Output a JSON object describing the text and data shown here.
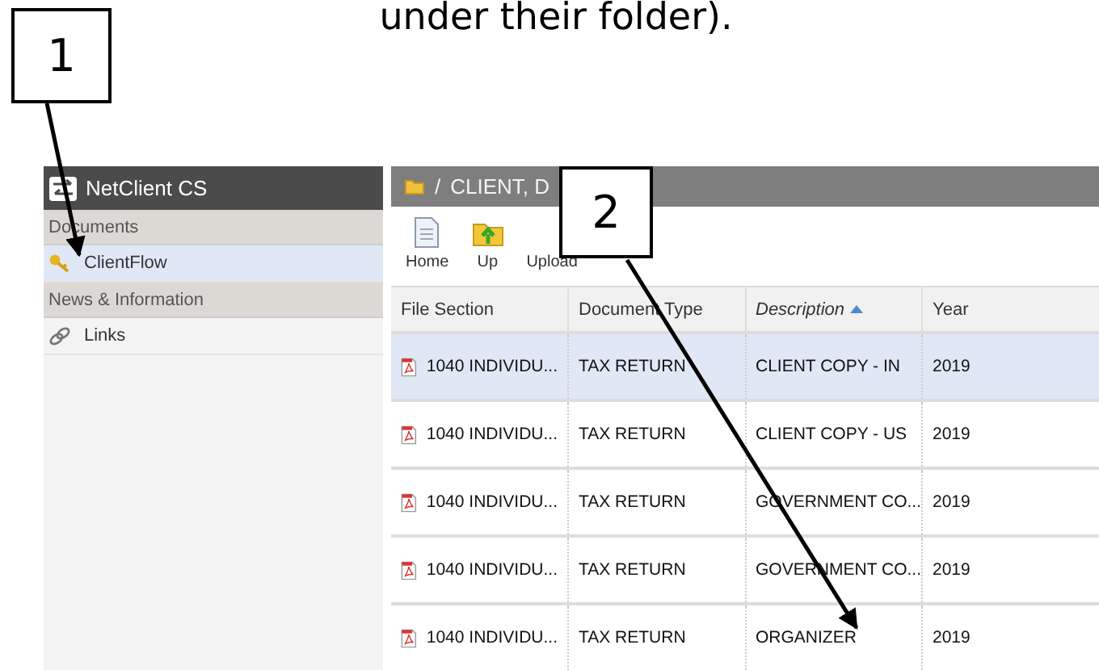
{
  "caption": "under their folder).",
  "callouts": [
    {
      "number": "1"
    },
    {
      "number": "2"
    }
  ],
  "sidebar": {
    "title": "NetClient CS",
    "sections": [
      {
        "heading": "Documents",
        "items": [
          {
            "label": "ClientFlow",
            "kind": "flow",
            "selected": true
          }
        ]
      },
      {
        "heading": "News & Information",
        "items": [
          {
            "label": "Links",
            "kind": "link",
            "selected": false
          }
        ]
      }
    ]
  },
  "path": {
    "separator": "/",
    "text": "CLIENT, D"
  },
  "toolbar": [
    {
      "label": "Home",
      "kind": "home"
    },
    {
      "label": "Up",
      "kind": "up"
    },
    {
      "label": "Upload",
      "kind": "upload"
    }
  ],
  "table": {
    "columns": [
      {
        "label": "File Section",
        "sorted": false
      },
      {
        "label": "Document Type",
        "sorted": false
      },
      {
        "label": "Description",
        "sorted": true
      },
      {
        "label": "Year",
        "sorted": false
      }
    ],
    "rows": [
      {
        "selected": true,
        "cells": [
          "1040 INDIVIDU...",
          "TAX RETURN",
          "CLIENT COPY - IN",
          "2019"
        ]
      },
      {
        "selected": false,
        "cells": [
          "1040 INDIVIDU...",
          "TAX RETURN",
          "CLIENT COPY - US",
          "2019"
        ]
      },
      {
        "selected": false,
        "cells": [
          "1040 INDIVIDU...",
          "TAX RETURN",
          "GOVERNMENT CO...",
          "2019"
        ]
      },
      {
        "selected": false,
        "cells": [
          "1040 INDIVIDU...",
          "TAX RETURN",
          "GOVERNMENT CO...",
          "2019"
        ]
      },
      {
        "selected": false,
        "cells": [
          "1040 INDIVIDU...",
          "TAX RETURN",
          "ORGANIZER",
          "2019"
        ]
      }
    ]
  }
}
